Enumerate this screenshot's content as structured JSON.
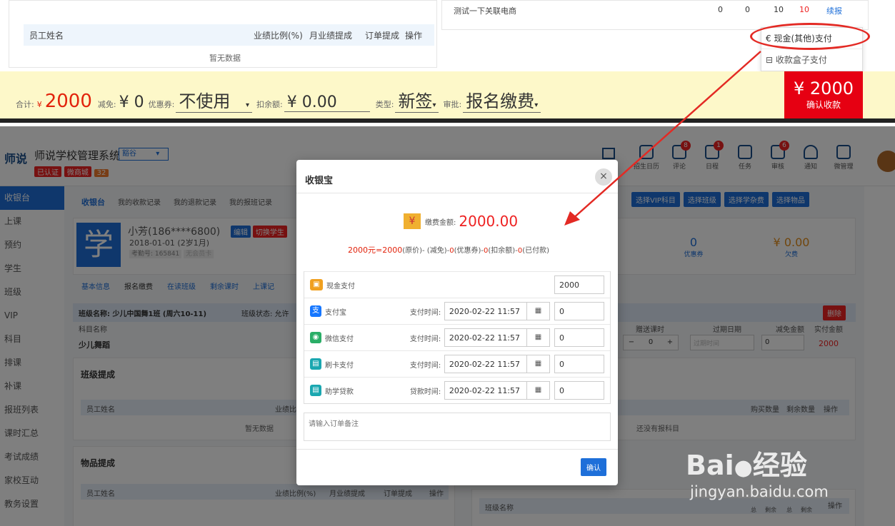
{
  "top": {
    "test_item": "测试一下关联电商",
    "test_cells": [
      "0",
      "0",
      "10",
      "10",
      "续报"
    ],
    "staff_header": [
      "员工姓名",
      "业绩比例(%)",
      "月业绩提成",
      "订单提成",
      "操作"
    ],
    "empty": "暂无数据",
    "dropdown": {
      "cash": "现金(其他)支付",
      "box": "收款盒子支付"
    },
    "summary": {
      "total_label": "合计:",
      "total_symbol": "¥",
      "total_value": "2000",
      "discount_label": "减免:",
      "discount_value": "¥ 0",
      "coupon_label": "优惠券:",
      "coupon_value": "不使用",
      "deduct_label": "扣余额:",
      "deduct_value": "¥ 0.00",
      "type_label": "类型:",
      "type_value": "新签",
      "approve_label": "审批:",
      "approve_value": "报名缴费"
    },
    "confirm_amount": "¥ 2000",
    "confirm_label": "确认收款"
  },
  "header": {
    "logo": "师说",
    "system_title": "师说学校管理系统",
    "school": "豁谷",
    "tags": [
      "已认证",
      "微商城",
      "32"
    ],
    "icons": [
      {
        "label": "招生日历",
        "badge": ""
      },
      {
        "label": "评论",
        "badge": "8"
      },
      {
        "label": "日程",
        "badge": "1"
      },
      {
        "label": "任务",
        "badge": ""
      },
      {
        "label": "审核",
        "badge": "6"
      },
      {
        "label": "通知",
        "badge": ""
      },
      {
        "label": "微管理",
        "badge": ""
      }
    ]
  },
  "sidebar": [
    "收银台",
    "上课",
    "预约",
    "学生",
    "班级",
    "VIP",
    "科目",
    "排课",
    "补课",
    "报班列表",
    "课时汇总",
    "考试成绩",
    "家校互动",
    "教务设置"
  ],
  "tabs": [
    "收银台",
    "我的收款记录",
    "我的退款记录",
    "我的报班记录"
  ],
  "student": {
    "avatar": "学",
    "name": "小芳(186****6800)",
    "edit": "编辑",
    "switch": "切换学生",
    "birth": "2018-01-01 (2岁1月)",
    "id": "考勤号: 165841",
    "member": "无会员卡"
  },
  "subtabs": [
    "基本信息",
    "报名缴费",
    "在读班级",
    "剩余课时",
    "上课记"
  ],
  "add_buttons": [
    "选择VIP科目",
    "选择班级",
    "选择学杂费",
    "选择物品"
  ],
  "stats": {
    "coupon_value": "0",
    "coupon_label": "优惠券",
    "owed_value": "¥ 0.00",
    "owed_label": "欠费"
  },
  "class_bar": {
    "label": "班级名称: 少儿中国舞1班 (周六10-11)",
    "status": "班级状态: 允许",
    "delete": "删除"
  },
  "course_headers": [
    "科目名称",
    "赠送课时",
    "过期日期",
    "减免金额",
    "实付金额"
  ],
  "course": {
    "name": "少儿舞蹈",
    "gift": "0",
    "expire_ph": "过期时间",
    "discount": "0",
    "paid": "2000"
  },
  "sections": {
    "class_commission": "班级提成",
    "item_commission": "物品提成",
    "no_class": "还没有报科目",
    "buy_qty": "购买数量",
    "remain_qty": "剩余数量",
    "op": "操作",
    "class_name": "班级名称",
    "sum": "总",
    "remain": "剩余"
  },
  "staff_header2": [
    "员工姓名",
    "业绩比例(%)",
    "月业绩提成",
    "订单提成",
    "操作"
  ],
  "empty2": "暂无数据",
  "modal": {
    "title": "收银宝",
    "close": "×",
    "amount_label": "缴费金额:",
    "amount": "2000.00",
    "formula_a": "2000元=",
    "formula_b": "2000",
    "formula_c": "(原价)- (减免)-",
    "formula_d": "0",
    "formula_e": "(优惠券)-",
    "formula_f": "0",
    "formula_g": "(扣余额)-",
    "formula_h": "0",
    "formula_i": "(已付款)",
    "methods": [
      {
        "name": "现金支付",
        "time_label": "",
        "time": "",
        "amount": "2000",
        "color": "#f0a020"
      },
      {
        "name": "支付宝",
        "time_label": "支付时间:",
        "time": "2020-02-22 11:57",
        "amount": "0",
        "color": "#1677ff"
      },
      {
        "name": "微信支付",
        "time_label": "支付时间:",
        "time": "2020-02-22 11:57",
        "amount": "0",
        "color": "#2aae67"
      },
      {
        "name": "刷卡支付",
        "time_label": "支付时间:",
        "time": "2020-02-22 11:57",
        "amount": "0",
        "color": "#1aa7b0"
      },
      {
        "name": "助学贷款",
        "time_label": "贷款时间:",
        "time": "2020-02-22 11:57",
        "amount": "0",
        "color": "#1aa7b0"
      }
    ],
    "remark_placeholder": "请输入订单备注",
    "confirm": "确认"
  },
  "watermark": {
    "brand": "Bai",
    "brand2": "经验",
    "url": "jingyan.baidu.com"
  }
}
